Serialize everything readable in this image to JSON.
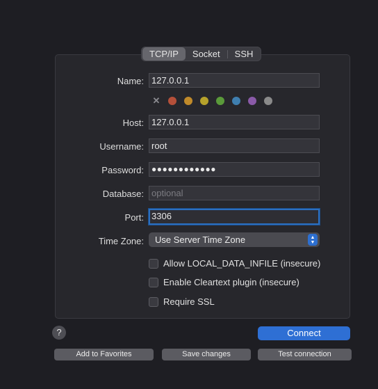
{
  "tabs": [
    {
      "label": "TCP/IP",
      "active": true
    },
    {
      "label": "Socket",
      "active": false
    },
    {
      "label": "SSH",
      "active": false
    }
  ],
  "form": {
    "name": {
      "label": "Name:",
      "value": "127.0.0.1"
    },
    "host": {
      "label": "Host:",
      "value": "127.0.0.1"
    },
    "username": {
      "label": "Username:",
      "value": "root"
    },
    "password": {
      "label": "Password:",
      "value": "●●●●●●●●●●●●"
    },
    "database": {
      "label": "Database:",
      "value": "",
      "placeholder": "optional"
    },
    "port": {
      "label": "Port:",
      "value": "3306"
    },
    "timezone": {
      "label": "Time Zone:",
      "value": "Use Server Time Zone"
    }
  },
  "colors": {
    "clear_icon": "close-icon",
    "swatches": [
      "#b5503a",
      "#c08a2a",
      "#b6a22b",
      "#5a9a3a",
      "#3f7fb0",
      "#8a5aa8",
      "#8a8a8a"
    ]
  },
  "checkboxes": [
    {
      "label": "Allow LOCAL_DATA_INFILE (insecure)",
      "checked": false
    },
    {
      "label": "Enable Cleartext plugin (insecure)",
      "checked": false
    },
    {
      "label": "Require SSL",
      "checked": false
    }
  ],
  "buttons": {
    "help": "?",
    "connect": "Connect",
    "add_to_favorites": "Add to Favorites",
    "save_changes": "Save changes",
    "test_connection": "Test connection"
  },
  "accent_color": "#2e6fd4"
}
